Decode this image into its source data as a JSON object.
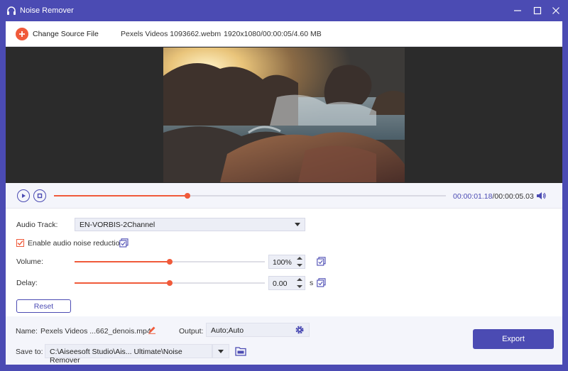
{
  "window": {
    "title": "Noise Remover",
    "controls": {
      "minimize_icon": "minimize-icon",
      "maximize_icon": "maximize-icon",
      "close_icon": "close-icon"
    }
  },
  "source": {
    "change_label": "Change Source File",
    "file_name": "Pexels Videos 1093662.webm",
    "file_meta": "1920x1080/00:00:05/4.60 MB"
  },
  "player": {
    "current_time": "00:00:01.18",
    "total_time": "/00:00:05.03",
    "progress": 0.34
  },
  "settings": {
    "audio_track_label": "Audio Track:",
    "audio_track_value": "EN-VORBIS-2Channel",
    "noise_reduction_label": "Enable audio noise reduction",
    "noise_reduction_checked": true,
    "volume_label": "Volume:",
    "volume_value": "100%",
    "volume_level": 0.5,
    "delay_label": "Delay:",
    "delay_value": "0.00",
    "delay_unit": "s",
    "delay_level": 0.5,
    "reset_label": "Reset"
  },
  "output": {
    "name_label": "Name:",
    "name_value": "Pexels Videos ...662_denois.mp4",
    "output_label": "Output:",
    "output_value": "Auto;Auto",
    "save_to_label": "Save to:",
    "save_to_value": "C:\\Aiseesoft Studio\\Ais... Ultimate\\Noise Remover",
    "export_label": "Export"
  },
  "colors": {
    "accent": "#4b4bb3",
    "highlight": "#f05a3a",
    "panel": "#f4f5fb"
  }
}
